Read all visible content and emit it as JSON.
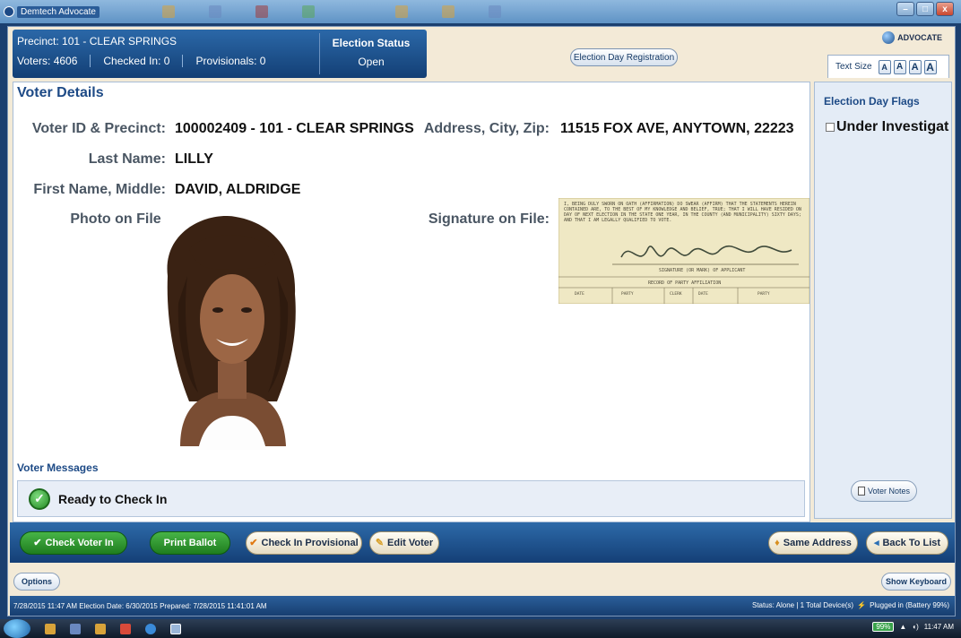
{
  "window": {
    "title": "Demtech Advocate"
  },
  "header": {
    "precinct": "Precinct: 101 - CLEAR SPRINGS",
    "voters": "Voters: 4606",
    "checked_in": "Checked In: 0",
    "provisionals": "Provisionals: 0",
    "election_status_label": "Election Status",
    "election_status_value": "Open"
  },
  "toolbar": {
    "edr_label": "Election Day Registration",
    "logo_text": "ADVOCATE",
    "text_size_label": "Text Size",
    "text_size_buttons": [
      "A",
      "A",
      "A",
      "A"
    ]
  },
  "voter": {
    "title": "Voter Details",
    "id_label": "Voter ID & Precinct:",
    "id_value": "100002409 -  101 - CLEAR SPRINGS",
    "address_label": "Address, City, Zip:",
    "address_value": "11515 FOX AVE,  ANYTOWN,  22223",
    "last_label": "Last Name:",
    "last_value": "LILLY",
    "first_label": "First Name, Middle:",
    "first_value": "DAVID,  ALDRIDGE",
    "photo_label": "Photo on File:",
    "signature_label": "Signature on File:",
    "signature_doc_text": "I, BEING DULY SWORN ON OATH (AFFIRMATION) DO SWEAR (AFFIRM) THAT THE STATEMENTS HEREIN CONTAINED ARE, TO THE BEST OF MY KNOWLEDGE AND BELIEF, TRUE; THAT I WILL HAVE RESIDED ON DAY OF NEXT ELECTION IN THE STATE ONE YEAR, IN THE COUNTY (AND MUNICIPALITY) SIXTY DAYS; AND THAT I AM LEGALLY QUALIFIED TO VOTE.",
    "signature_name": "Vernon Lee Dalton",
    "signature_caption": "SIGNATURE (OR MARK) OF APPLICANT",
    "party_record": "RECORD OF PARTY AFFILIATION",
    "party_cols": [
      "DATE",
      "PARTY",
      "CLERK",
      "DATE",
      "PARTY"
    ]
  },
  "messages": {
    "label": "Voter Messages",
    "text": "Ready to Check In"
  },
  "flags": {
    "title": "Election Day Flags",
    "items": [
      "Under Investigat"
    ],
    "notes_button": "Voter Notes"
  },
  "actions": {
    "check_in": "Check Voter In",
    "print_ballot": "Print Ballot",
    "provisional": "Check In Provisional",
    "edit": "Edit Voter",
    "same_address": "Same Address",
    "back": "Back To List"
  },
  "bottom": {
    "options": "Options",
    "show_keyboard": "Show Keyboard"
  },
  "status": {
    "left": "7/28/2015 11:47 AM    Election Date:  6/30/2015    Prepared:  7/28/2015 11:41:01 AM",
    "right": "Status: Alone  |  1 Total Device(s)",
    "power": "Plugged in (Battery 99%)"
  },
  "taskbar": {
    "battery": "99%",
    "time": "11:47 AM"
  }
}
